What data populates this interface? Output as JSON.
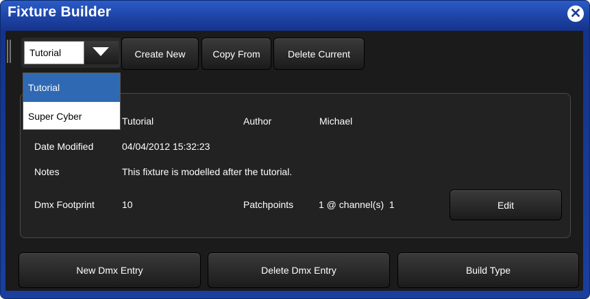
{
  "window": {
    "title": "Fixture Builder",
    "close_glyph": "✕"
  },
  "toolbar": {
    "selector_value": "Tutorial",
    "create_new": "Create New",
    "copy_from": "Copy From",
    "delete_current": "Delete Current"
  },
  "dropdown": {
    "options": [
      "Tutorial",
      "Super Cyber"
    ],
    "selected": "Tutorial"
  },
  "fixture": {
    "name_value": "Tutorial",
    "author_label": "Author",
    "author_value": "Michael",
    "date_modified_label": "Date Modified",
    "date_modified_value": "04/04/2012 15:32:23",
    "notes_label": "Notes",
    "notes_value": "This fixture is modelled after the tutorial.",
    "dmx_footprint_label": "Dmx Footprint",
    "dmx_footprint_value": "10",
    "patchpoints_label": "Patchpoints",
    "patchpoints_value": "1 @ channel(s)  1",
    "edit_label": "Edit"
  },
  "actions": {
    "new_dmx_entry": "New Dmx Entry",
    "delete_dmx_entry": "Delete Dmx Entry",
    "build_type": "Build Type"
  },
  "colors": {
    "title_bar": "#2047ab",
    "panel": "#1b1b1b",
    "selected_option": "#2f69b3"
  }
}
